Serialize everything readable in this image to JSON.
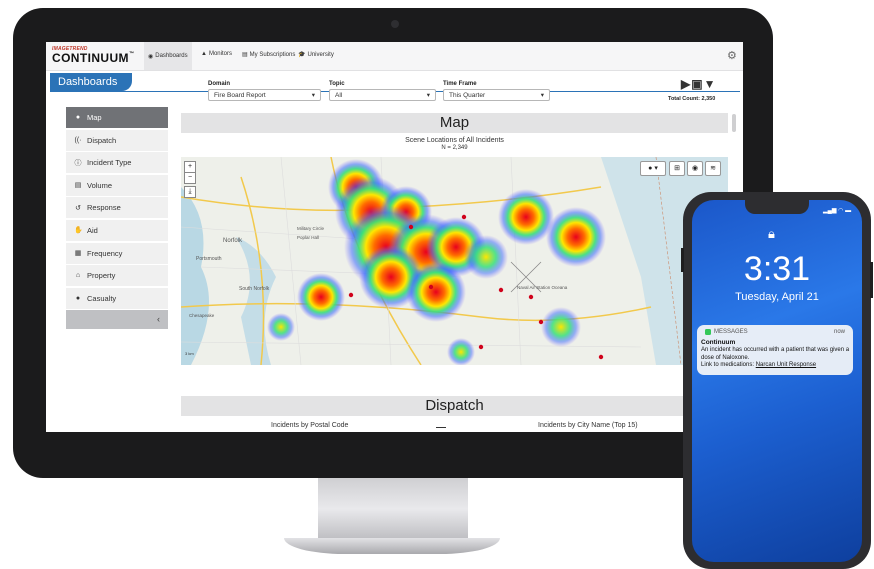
{
  "app": {
    "brand_sub": "IMAGETREND",
    "brand_main": "CONTINUUM",
    "brand_tm": "™"
  },
  "nav": {
    "items": [
      {
        "label": "Dashboards",
        "icon": "dashboard-icon"
      },
      {
        "label": "Monitors",
        "icon": "warning-icon"
      },
      {
        "label": "My Subscriptions",
        "icon": "newspaper-icon"
      },
      {
        "label": "University",
        "icon": "graduation-cap-icon"
      }
    ]
  },
  "page": {
    "title": "Dashboards"
  },
  "sidebar": {
    "items": [
      {
        "label": "Map",
        "active": true
      },
      {
        "label": "Dispatch"
      },
      {
        "label": "Incident Type"
      },
      {
        "label": "Volume"
      },
      {
        "label": "Response"
      },
      {
        "label": "Aid"
      },
      {
        "label": "Frequency"
      },
      {
        "label": "Property"
      },
      {
        "label": "Casualty"
      }
    ],
    "collapse_glyph": "‹"
  },
  "filters": {
    "domain": {
      "label": "Domain",
      "value": "Fire Board Report"
    },
    "topic": {
      "label": "Topic",
      "value": "All"
    },
    "timeframe": {
      "label": "Time Frame",
      "value": "This Quarter"
    }
  },
  "summary": {
    "total_count": "Total Count: 2,350"
  },
  "map_section": {
    "title": "Map",
    "subtitle": "Scene Locations of All Incidents",
    "n": "N = 2,349",
    "places": [
      "Norfolk",
      "Portsmouth",
      "South Norfolk",
      "Military Circle",
      "Poplar Hall",
      "Naval Air Station Oceana",
      "Chesapeake"
    ],
    "zoom_in": "+",
    "zoom_out": "−",
    "scale": "3 km"
  },
  "dispatch_section": {
    "title": "Dispatch",
    "chart_left": "Incidents by Postal Code",
    "chart_right": "Incidents by City Name (Top 15)"
  },
  "phone": {
    "time": "3:31",
    "date": "Tuesday, April 21",
    "notification": {
      "app": "MESSAGES",
      "time": "now",
      "title": "Continuum",
      "body": "An incident has occurred with a patient that was given a dose of Naloxone.",
      "link_prefix": "Link to medications:",
      "link": "Narcan Unit Response"
    }
  },
  "colors": {
    "accent": "#2b73b7",
    "menu_active": "#707276",
    "heat_hot": "#e8001e",
    "heat_warm": "#ffe600",
    "heat_cool": "#3b6bff"
  }
}
